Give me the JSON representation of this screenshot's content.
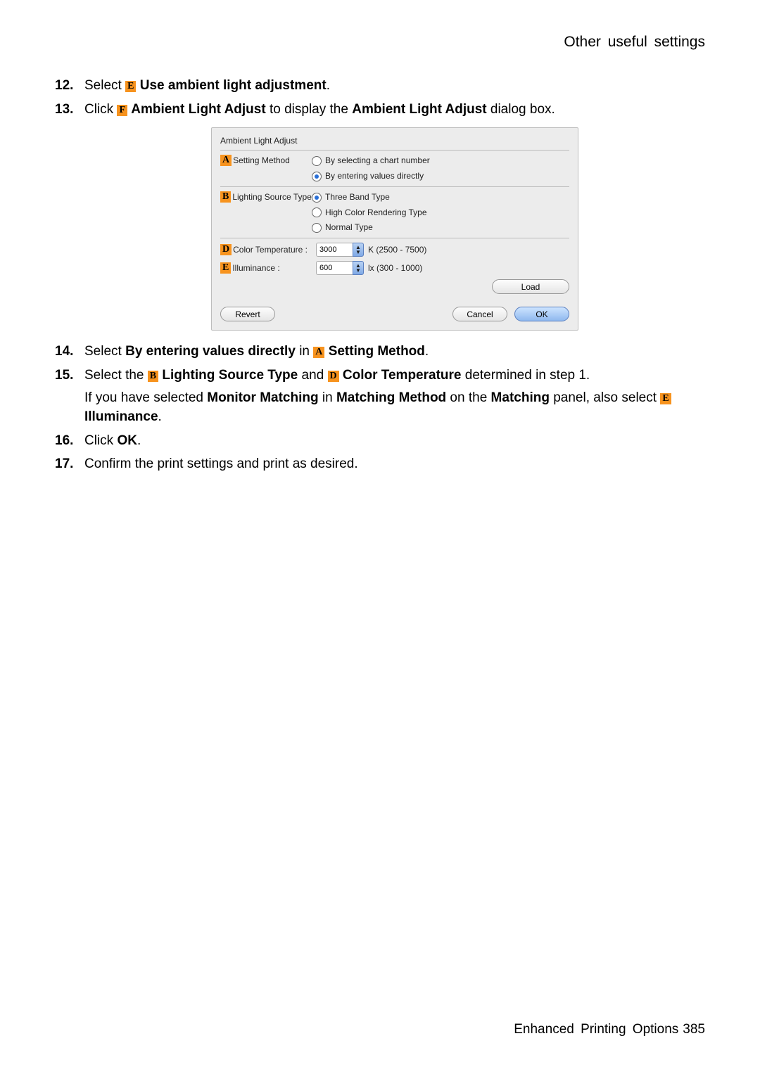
{
  "header": {
    "section_title": "Other useful settings"
  },
  "steps": [
    {
      "num": "12.",
      "parts": [
        "Select ",
        {
          "callout": "E"
        },
        " ",
        {
          "bold": "Use ambient light adjustment"
        },
        "."
      ]
    },
    {
      "num": "13.",
      "parts": [
        "Click ",
        {
          "callout": "F"
        },
        " ",
        {
          "bold": "Ambient Light Adjust"
        },
        " to display the ",
        {
          "bold": "Ambient Light Adjust"
        },
        " dialog box."
      ]
    },
    {
      "num": "14.",
      "parts": [
        "Select ",
        {
          "bold": "By entering values directly"
        },
        " in ",
        {
          "callout": "A"
        },
        " ",
        {
          "bold": "Setting Method"
        },
        "."
      ]
    },
    {
      "num": "15.",
      "parts": [
        "Select the ",
        {
          "callout": "B"
        },
        " ",
        {
          "bold": "Lighting Source Type"
        },
        " and ",
        {
          "callout": "D"
        },
        " ",
        {
          "bold": "Color Temperature"
        },
        " determined in step 1."
      ],
      "cont": [
        "If you have selected ",
        {
          "bold": "Monitor Matching"
        },
        " in ",
        {
          "bold": "Matching Method"
        },
        " on the ",
        {
          "bold": "Matching"
        },
        " panel, also select ",
        {
          "callout": "E"
        },
        " ",
        {
          "bold": "Illuminance"
        },
        "."
      ]
    },
    {
      "num": "16.",
      "parts": [
        "Click ",
        {
          "bold": "OK"
        },
        "."
      ]
    },
    {
      "num": "17.",
      "parts": [
        "Confirm the print settings and print as desired."
      ]
    }
  ],
  "dialog": {
    "title": "Ambient Light Adjust",
    "A": {
      "callout": "A",
      "label": "Setting Method",
      "options": [
        {
          "label": "By selecting a chart number",
          "selected": false
        },
        {
          "label": "By entering values directly",
          "selected": true
        }
      ]
    },
    "B": {
      "callout": "B",
      "label": "Lighting Source Type",
      "options": [
        {
          "label": "Three Band Type",
          "selected": true
        },
        {
          "label": "High Color Rendering Type",
          "selected": false
        },
        {
          "label": "Normal Type",
          "selected": false
        }
      ]
    },
    "D": {
      "callout": "D",
      "label": "Color Temperature :",
      "value": "3000",
      "range": "K (2500 - 7500)"
    },
    "E": {
      "callout": "E",
      "label": "Illuminance :",
      "value": "600",
      "range": "lx (300 - 1000)"
    },
    "buttons": {
      "load": "Load",
      "revert": "Revert",
      "cancel": "Cancel",
      "ok": "OK"
    }
  },
  "footer": {
    "chapter": "Enhanced Printing Options",
    "page": "385"
  }
}
